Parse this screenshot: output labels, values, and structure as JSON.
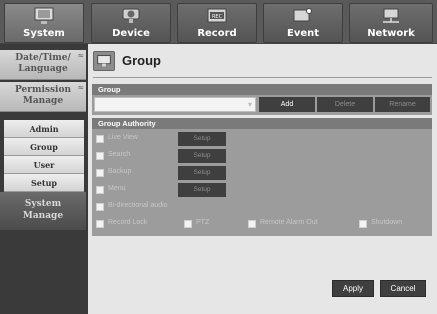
{
  "top_tabs": [
    {
      "label": "System",
      "icon": "monitor-icon"
    },
    {
      "label": "Device",
      "icon": "camera-icon"
    },
    {
      "label": "Record",
      "icon": "rec-icon"
    },
    {
      "label": "Event",
      "icon": "event-icon"
    },
    {
      "label": "Network",
      "icon": "network-icon"
    }
  ],
  "sidebar": {
    "date_time": {
      "line1": "Date/Time/",
      "line2": "Language",
      "mark": "≈"
    },
    "permission": {
      "line1": "Permission",
      "line2": "Manage",
      "mark": "≈"
    },
    "items": [
      "Admin",
      "Group",
      "User",
      "Setup"
    ],
    "system": {
      "line1": "System",
      "line2": "Manage"
    }
  },
  "main": {
    "title": "Group",
    "group_panel": {
      "header": "Group",
      "select_value": "",
      "add_label": "Add",
      "delete_label": "Delete",
      "rename_label": "Rename"
    },
    "authority_panel": {
      "header": "Group Authority",
      "rows": [
        {
          "label": "Live View",
          "setup": "Setup"
        },
        {
          "label": "Search",
          "setup": "Setup"
        },
        {
          "label": "Backup",
          "setup": "Setup"
        },
        {
          "label": "Menu",
          "setup": "Setup"
        }
      ],
      "bidirectional": "Bi-directional audio",
      "bottom_row": [
        "Record Lock",
        "PTZ",
        "Remote Alarm Out",
        "Shutdown"
      ]
    },
    "apply_label": "Apply",
    "cancel_label": "Cancel"
  },
  "colors": {
    "background": "#e6e6e6",
    "sidebar": "#3a3a3a",
    "button": "#3f3f3f",
    "panel": "#9c9c9c"
  }
}
